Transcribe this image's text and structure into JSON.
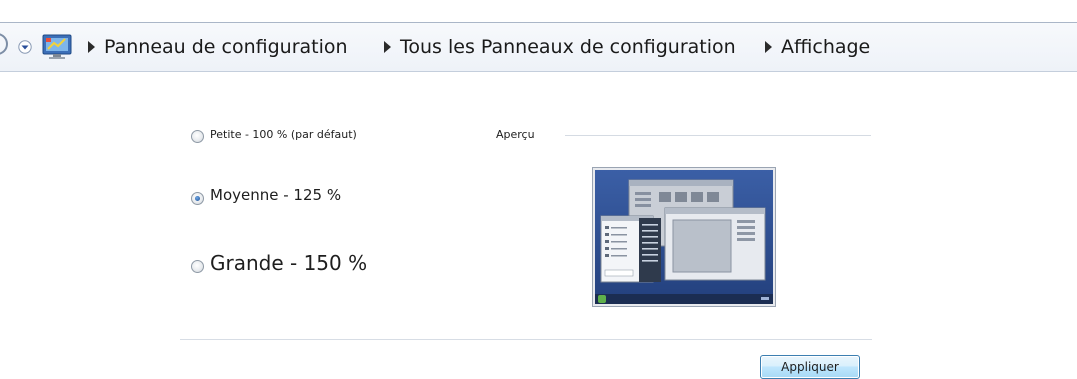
{
  "breadcrumb": {
    "items": [
      {
        "label": "Panneau de configuration"
      },
      {
        "label": "Tous les Panneaux de configuration"
      },
      {
        "label": "Affichage"
      }
    ],
    "icon": "control-panel-icon"
  },
  "options": [
    {
      "label": "Petite - 100 % (par défaut)",
      "selected": false
    },
    {
      "label": "Moyenne - 125 %",
      "selected": true
    },
    {
      "label": "Grande - 150 %",
      "selected": false
    }
  ],
  "preview": {
    "caption": "Aperçu"
  },
  "actions": {
    "apply_label": "Appliquer"
  },
  "colors": {
    "desktop_blue": "#2f4f8e",
    "window_face": "#f2f4f7",
    "button_border": "#3c7fb1"
  }
}
